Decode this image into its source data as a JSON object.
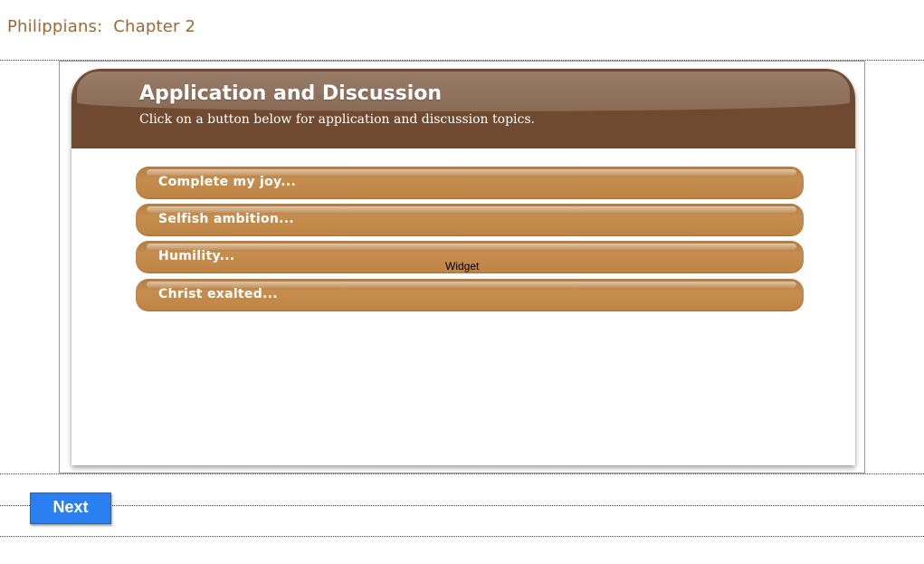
{
  "page": {
    "title": "Philippians:  Chapter 2"
  },
  "card": {
    "title": "Application and Discussion",
    "subtitle": "Click on a button below for application and discussion topics.",
    "topics": [
      {
        "label": "Complete my joy..."
      },
      {
        "label": "Selfish ambition..."
      },
      {
        "label": "Humility..."
      },
      {
        "label": "Christ exalted..."
      }
    ],
    "widget_label": "Widget"
  },
  "nav": {
    "next_label": "Next"
  },
  "colors": {
    "title_text": "#9a6a35",
    "header_brown": "#6f4a30",
    "topic_button": "#c08748",
    "next_button": "#2a80f0"
  }
}
